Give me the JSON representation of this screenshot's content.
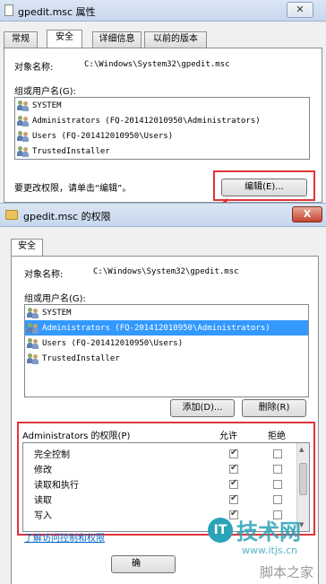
{
  "properties_window": {
    "title": "gpedit.msc 属性",
    "tabs": [
      {
        "label": "常规"
      },
      {
        "label": "安全"
      },
      {
        "label": "详细信息"
      },
      {
        "label": "以前的版本"
      }
    ],
    "object_name_label": "对象名称:",
    "object_name_value": "C:\\Windows\\System32\\gpedit.msc",
    "group_label": "组或用户名(G):",
    "users": [
      "SYSTEM",
      "Administrators (FQ-201412010950\\Administrators)",
      "Users (FQ-201412010950\\Users)",
      "TrustedInstaller"
    ],
    "edit_hint": "要更改权限，请单击“编辑”。",
    "edit_button": "编辑(E)..."
  },
  "permissions_window": {
    "title": "gpedit.msc 的权限",
    "close_label": "X",
    "tab": "安全",
    "object_name_label": "对象名称:",
    "object_name_value": "C:\\Windows\\System32\\gpedit.msc",
    "group_label": "组或用户名(G):",
    "users": [
      "SYSTEM",
      "Administrators (FQ-201412010950\\Administrators)",
      "Users (FQ-201412010950\\Users)",
      "TrustedInstaller"
    ],
    "selected_user_index": 1,
    "add_button": "添加(D)...",
    "remove_button": "删除(R)",
    "perm_header": "Administrators 的权限(P)",
    "allow_header": "允许",
    "deny_header": "拒绝",
    "permissions": [
      {
        "name": "完全控制",
        "allow": true,
        "deny": false
      },
      {
        "name": "修改",
        "allow": true,
        "deny": false
      },
      {
        "name": "读取和执行",
        "allow": true,
        "deny": false
      },
      {
        "name": "读取",
        "allow": true,
        "deny": false
      },
      {
        "name": "写入",
        "allow": true,
        "deny": false
      }
    ],
    "learn_link": "了解访问控制和权限",
    "ok_button": "确"
  },
  "watermark": {
    "brand": "技术网",
    "url": "www.itjs.cn",
    "footer": "脚本之家"
  },
  "colors": {
    "highlight": "#e0353b",
    "selection": "#3399ff"
  }
}
